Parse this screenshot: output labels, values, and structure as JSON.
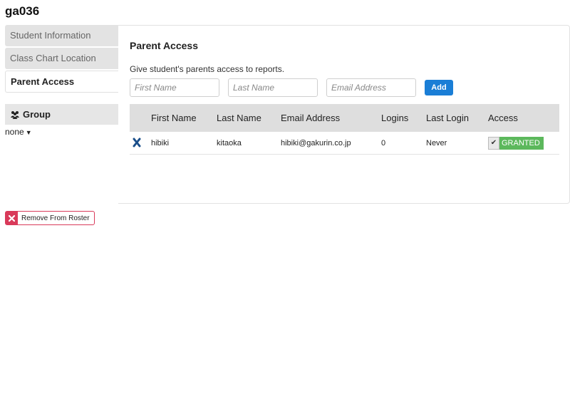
{
  "student": {
    "id": "ga036"
  },
  "nav": {
    "tabs": [
      {
        "label": "Student Information",
        "active": false
      },
      {
        "label": "Class Chart Location",
        "active": false
      },
      {
        "label": "Parent Access",
        "active": true
      }
    ]
  },
  "group": {
    "header": "Group",
    "icon": "group-icon",
    "selected": "none"
  },
  "parent_access": {
    "title": "Parent Access",
    "description": "Give student's parents access to reports.",
    "first_name_placeholder": "First Name",
    "last_name_placeholder": "Last Name",
    "email_placeholder": "Email Address",
    "add_label": "Add",
    "columns": [
      "First Name",
      "Last Name",
      "Email Address",
      "Logins",
      "Last Login",
      "Access"
    ],
    "rows": [
      {
        "first_name": "hibiki",
        "last_name": "kitaoka",
        "email": "hibiki@gakurin.co.jp",
        "logins": "0",
        "last_login": "Never",
        "access": "GRANTED"
      }
    ]
  },
  "actions": {
    "remove_label": "Remove From Roster"
  },
  "colors": {
    "accent": "#1a7ed6",
    "granted": "#5cb85c",
    "danger": "#d93a5a",
    "delete_icon": "#1b4f8a"
  }
}
